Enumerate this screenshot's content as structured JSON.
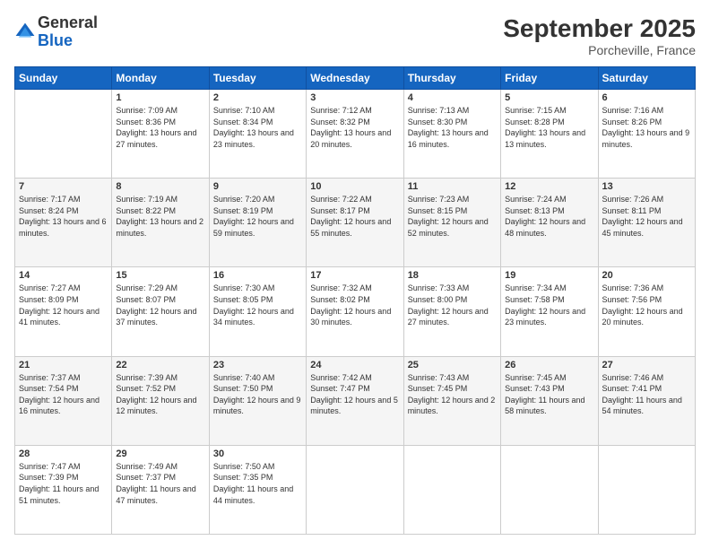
{
  "header": {
    "logo_general": "General",
    "logo_blue": "Blue",
    "month_title": "September 2025",
    "location": "Porcheville, France"
  },
  "weekdays": [
    "Sunday",
    "Monday",
    "Tuesday",
    "Wednesday",
    "Thursday",
    "Friday",
    "Saturday"
  ],
  "weeks": [
    [
      {
        "day": "",
        "sunrise": "",
        "sunset": "",
        "daylight": ""
      },
      {
        "day": "1",
        "sunrise": "Sunrise: 7:09 AM",
        "sunset": "Sunset: 8:36 PM",
        "daylight": "Daylight: 13 hours and 27 minutes."
      },
      {
        "day": "2",
        "sunrise": "Sunrise: 7:10 AM",
        "sunset": "Sunset: 8:34 PM",
        "daylight": "Daylight: 13 hours and 23 minutes."
      },
      {
        "day": "3",
        "sunrise": "Sunrise: 7:12 AM",
        "sunset": "Sunset: 8:32 PM",
        "daylight": "Daylight: 13 hours and 20 minutes."
      },
      {
        "day": "4",
        "sunrise": "Sunrise: 7:13 AM",
        "sunset": "Sunset: 8:30 PM",
        "daylight": "Daylight: 13 hours and 16 minutes."
      },
      {
        "day": "5",
        "sunrise": "Sunrise: 7:15 AM",
        "sunset": "Sunset: 8:28 PM",
        "daylight": "Daylight: 13 hours and 13 minutes."
      },
      {
        "day": "6",
        "sunrise": "Sunrise: 7:16 AM",
        "sunset": "Sunset: 8:26 PM",
        "daylight": "Daylight: 13 hours and 9 minutes."
      }
    ],
    [
      {
        "day": "7",
        "sunrise": "Sunrise: 7:17 AM",
        "sunset": "Sunset: 8:24 PM",
        "daylight": "Daylight: 13 hours and 6 minutes."
      },
      {
        "day": "8",
        "sunrise": "Sunrise: 7:19 AM",
        "sunset": "Sunset: 8:22 PM",
        "daylight": "Daylight: 13 hours and 2 minutes."
      },
      {
        "day": "9",
        "sunrise": "Sunrise: 7:20 AM",
        "sunset": "Sunset: 8:19 PM",
        "daylight": "Daylight: 12 hours and 59 minutes."
      },
      {
        "day": "10",
        "sunrise": "Sunrise: 7:22 AM",
        "sunset": "Sunset: 8:17 PM",
        "daylight": "Daylight: 12 hours and 55 minutes."
      },
      {
        "day": "11",
        "sunrise": "Sunrise: 7:23 AM",
        "sunset": "Sunset: 8:15 PM",
        "daylight": "Daylight: 12 hours and 52 minutes."
      },
      {
        "day": "12",
        "sunrise": "Sunrise: 7:24 AM",
        "sunset": "Sunset: 8:13 PM",
        "daylight": "Daylight: 12 hours and 48 minutes."
      },
      {
        "day": "13",
        "sunrise": "Sunrise: 7:26 AM",
        "sunset": "Sunset: 8:11 PM",
        "daylight": "Daylight: 12 hours and 45 minutes."
      }
    ],
    [
      {
        "day": "14",
        "sunrise": "Sunrise: 7:27 AM",
        "sunset": "Sunset: 8:09 PM",
        "daylight": "Daylight: 12 hours and 41 minutes."
      },
      {
        "day": "15",
        "sunrise": "Sunrise: 7:29 AM",
        "sunset": "Sunset: 8:07 PM",
        "daylight": "Daylight: 12 hours and 37 minutes."
      },
      {
        "day": "16",
        "sunrise": "Sunrise: 7:30 AM",
        "sunset": "Sunset: 8:05 PM",
        "daylight": "Daylight: 12 hours and 34 minutes."
      },
      {
        "day": "17",
        "sunrise": "Sunrise: 7:32 AM",
        "sunset": "Sunset: 8:02 PM",
        "daylight": "Daylight: 12 hours and 30 minutes."
      },
      {
        "day": "18",
        "sunrise": "Sunrise: 7:33 AM",
        "sunset": "Sunset: 8:00 PM",
        "daylight": "Daylight: 12 hours and 27 minutes."
      },
      {
        "day": "19",
        "sunrise": "Sunrise: 7:34 AM",
        "sunset": "Sunset: 7:58 PM",
        "daylight": "Daylight: 12 hours and 23 minutes."
      },
      {
        "day": "20",
        "sunrise": "Sunrise: 7:36 AM",
        "sunset": "Sunset: 7:56 PM",
        "daylight": "Daylight: 12 hours and 20 minutes."
      }
    ],
    [
      {
        "day": "21",
        "sunrise": "Sunrise: 7:37 AM",
        "sunset": "Sunset: 7:54 PM",
        "daylight": "Daylight: 12 hours and 16 minutes."
      },
      {
        "day": "22",
        "sunrise": "Sunrise: 7:39 AM",
        "sunset": "Sunset: 7:52 PM",
        "daylight": "Daylight: 12 hours and 12 minutes."
      },
      {
        "day": "23",
        "sunrise": "Sunrise: 7:40 AM",
        "sunset": "Sunset: 7:50 PM",
        "daylight": "Daylight: 12 hours and 9 minutes."
      },
      {
        "day": "24",
        "sunrise": "Sunrise: 7:42 AM",
        "sunset": "Sunset: 7:47 PM",
        "daylight": "Daylight: 12 hours and 5 minutes."
      },
      {
        "day": "25",
        "sunrise": "Sunrise: 7:43 AM",
        "sunset": "Sunset: 7:45 PM",
        "daylight": "Daylight: 12 hours and 2 minutes."
      },
      {
        "day": "26",
        "sunrise": "Sunrise: 7:45 AM",
        "sunset": "Sunset: 7:43 PM",
        "daylight": "Daylight: 11 hours and 58 minutes."
      },
      {
        "day": "27",
        "sunrise": "Sunrise: 7:46 AM",
        "sunset": "Sunset: 7:41 PM",
        "daylight": "Daylight: 11 hours and 54 minutes."
      }
    ],
    [
      {
        "day": "28",
        "sunrise": "Sunrise: 7:47 AM",
        "sunset": "Sunset: 7:39 PM",
        "daylight": "Daylight: 11 hours and 51 minutes."
      },
      {
        "day": "29",
        "sunrise": "Sunrise: 7:49 AM",
        "sunset": "Sunset: 7:37 PM",
        "daylight": "Daylight: 11 hours and 47 minutes."
      },
      {
        "day": "30",
        "sunrise": "Sunrise: 7:50 AM",
        "sunset": "Sunset: 7:35 PM",
        "daylight": "Daylight: 11 hours and 44 minutes."
      },
      {
        "day": "",
        "sunrise": "",
        "sunset": "",
        "daylight": ""
      },
      {
        "day": "",
        "sunrise": "",
        "sunset": "",
        "daylight": ""
      },
      {
        "day": "",
        "sunrise": "",
        "sunset": "",
        "daylight": ""
      },
      {
        "day": "",
        "sunrise": "",
        "sunset": "",
        "daylight": ""
      }
    ]
  ]
}
